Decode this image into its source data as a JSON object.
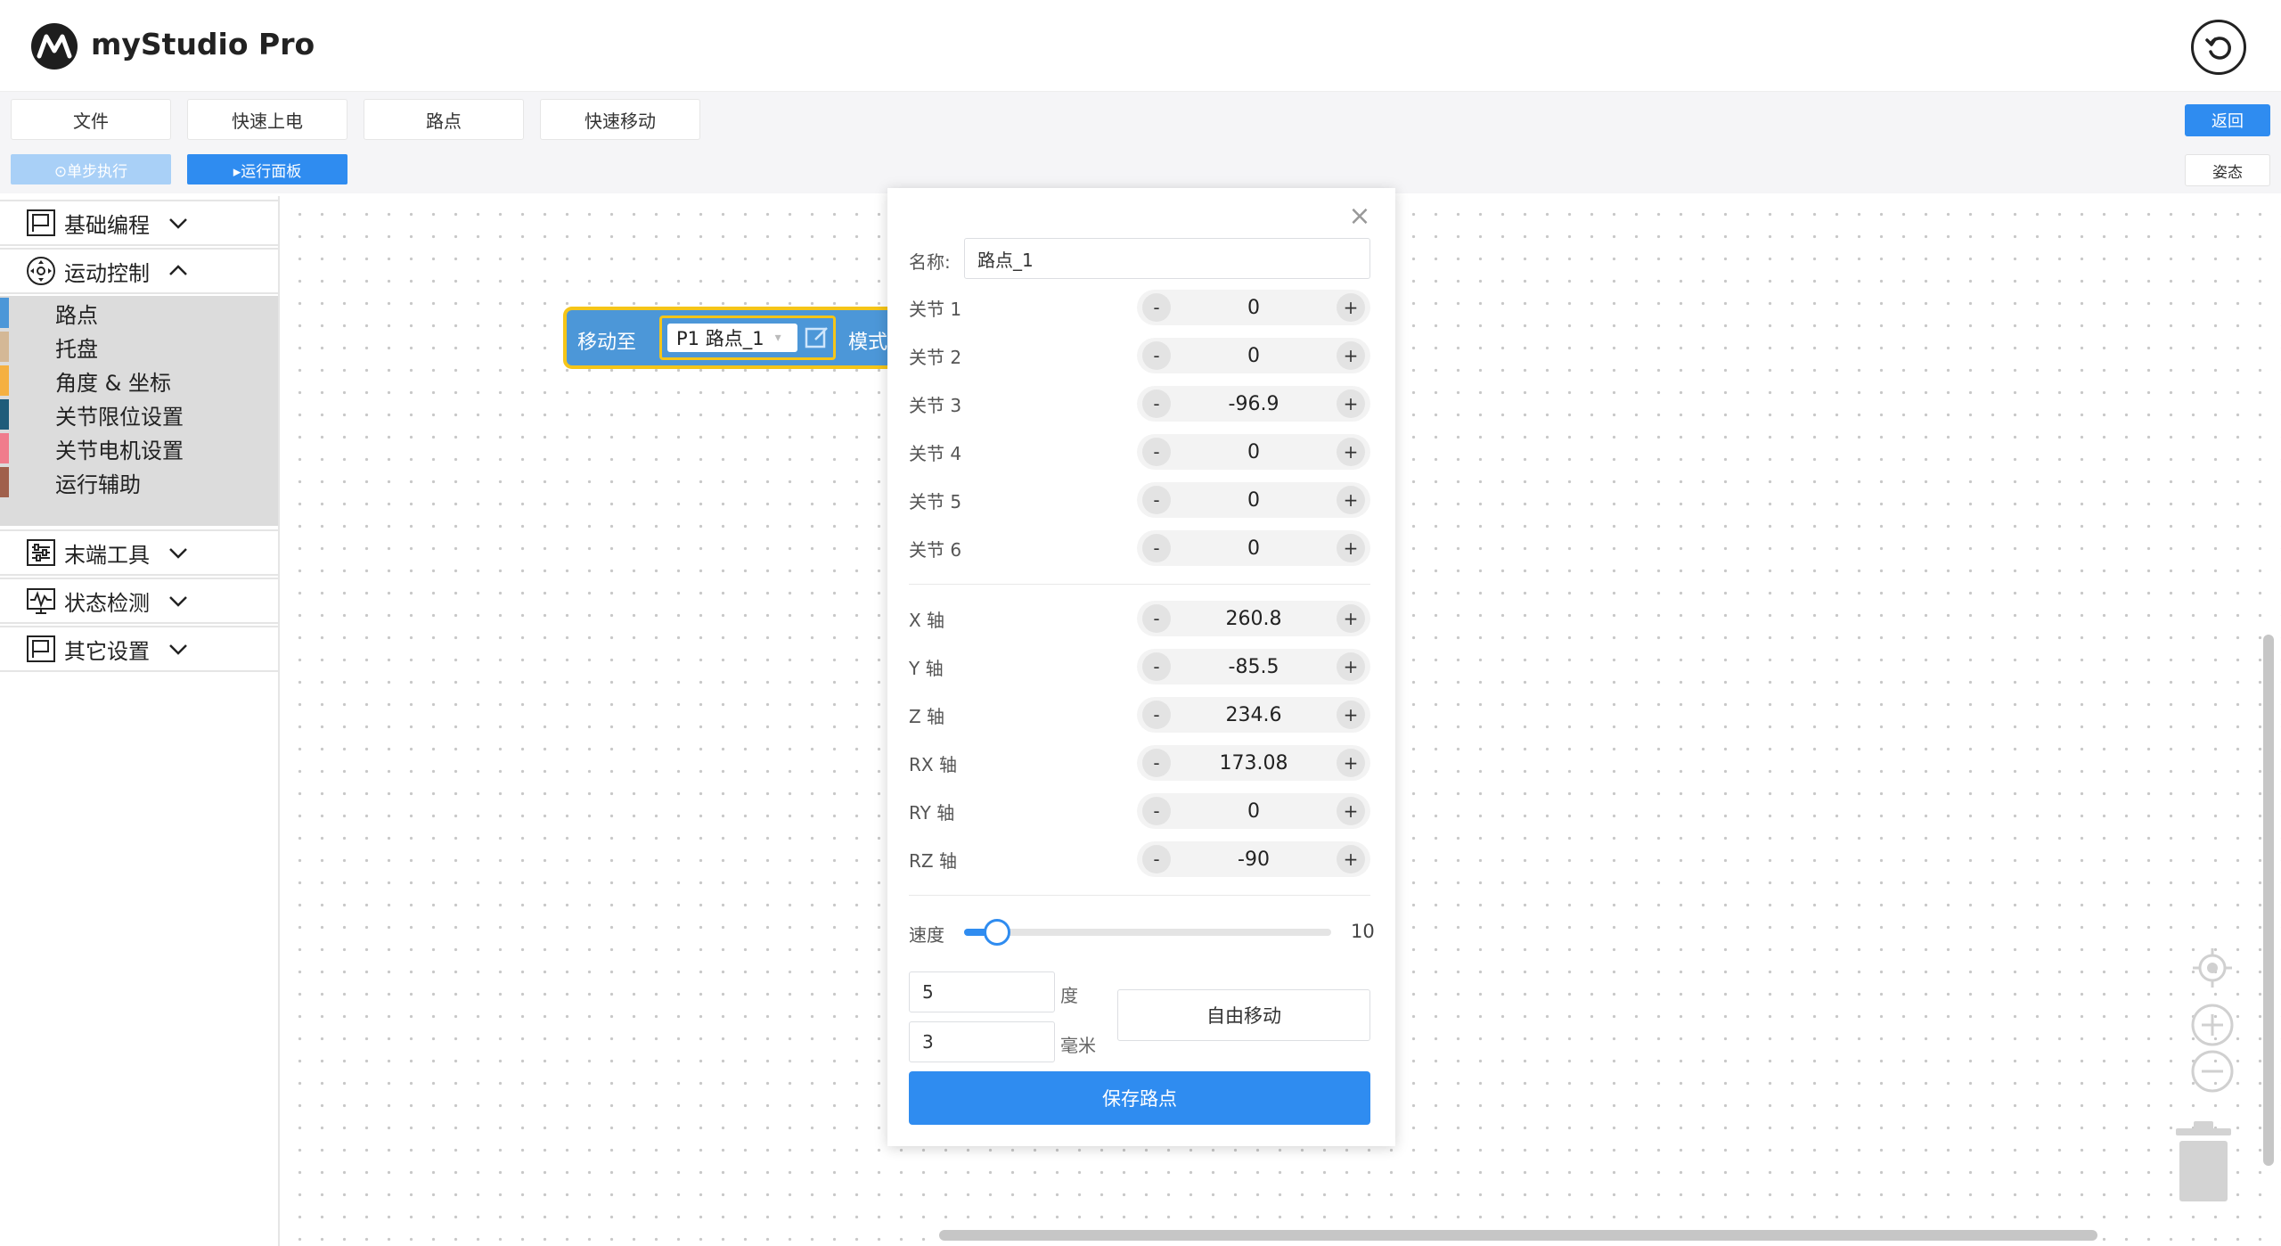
{
  "app": {
    "title": "myStudio Pro"
  },
  "toolbar": {
    "menu": [
      "文件",
      "快速上电",
      "路点",
      "快速移动"
    ],
    "step_label": "⊙单步执行",
    "run_panel_label": "▸运行面板",
    "back_label": "返回",
    "pose_label": "姿态"
  },
  "sidebar": {
    "categories": [
      {
        "label": "基础编程",
        "icon": "flag-icon",
        "expanded": false
      },
      {
        "label": "运动控制",
        "icon": "move-icon",
        "expanded": true
      },
      {
        "label": "末端工具",
        "icon": "sliders-icon",
        "expanded": false
      },
      {
        "label": "状态检测",
        "icon": "monitor-icon",
        "expanded": false
      },
      {
        "label": "其它设置",
        "icon": "flag-icon",
        "expanded": false
      }
    ],
    "motion_items": [
      {
        "label": "路点",
        "color": "#4c97d8"
      },
      {
        "label": "托盘",
        "color": "#d4b896"
      },
      {
        "label": "角度 & 坐标",
        "color": "#f5b041"
      },
      {
        "label": "关节限位设置",
        "color": "#1f5c7a"
      },
      {
        "label": "关节电机设置",
        "color": "#f07c8c"
      },
      {
        "label": "运行辅助",
        "color": "#a0604c"
      }
    ]
  },
  "block": {
    "label": "移动至",
    "waypoint": "P1 路点_1",
    "mode_label": "模式"
  },
  "dialog": {
    "name_label": "名称:",
    "name_value": "路点_1",
    "joints": [
      {
        "label": "关节 1",
        "value": "0"
      },
      {
        "label": "关节 2",
        "value": "0"
      },
      {
        "label": "关节 3",
        "value": "-96.9"
      },
      {
        "label": "关节 4",
        "value": "0"
      },
      {
        "label": "关节 5",
        "value": "0"
      },
      {
        "label": "关节 6",
        "value": "0"
      }
    ],
    "axes": [
      {
        "label": "X 轴",
        "value": "260.8"
      },
      {
        "label": "Y 轴",
        "value": "-85.5"
      },
      {
        "label": "Z 轴",
        "value": "234.6"
      },
      {
        "label": "RX 轴",
        "value": "173.08"
      },
      {
        "label": "RY 轴",
        "value": "0"
      },
      {
        "label": "RZ 轴",
        "value": "-90"
      }
    ],
    "minus": "-",
    "plus": "+",
    "speed_label": "速度",
    "speed_value": "10",
    "speed_fraction": 0.09,
    "angle_step": "5",
    "angle_unit": "度",
    "dist_step": "3",
    "dist_unit": "毫米",
    "free_move_label": "自由移动",
    "save_label": "保存路点"
  },
  "colors": {
    "accent": "#2f8cf0",
    "block": "#4c97d8",
    "block_border": "#f5c518"
  }
}
